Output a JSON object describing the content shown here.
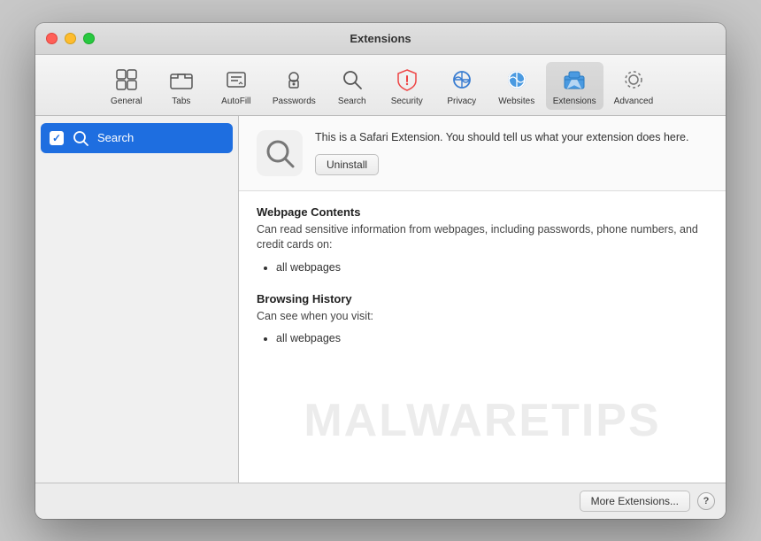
{
  "window": {
    "title": "Extensions",
    "controls": {
      "close": "close",
      "minimize": "minimize",
      "maximize": "maximize"
    }
  },
  "toolbar": {
    "items": [
      {
        "id": "general",
        "label": "General",
        "icon": "general"
      },
      {
        "id": "tabs",
        "label": "Tabs",
        "icon": "tabs"
      },
      {
        "id": "autofill",
        "label": "AutoFill",
        "icon": "autofill"
      },
      {
        "id": "passwords",
        "label": "Passwords",
        "icon": "passwords"
      },
      {
        "id": "search",
        "label": "Search",
        "icon": "search"
      },
      {
        "id": "security",
        "label": "Security",
        "icon": "security"
      },
      {
        "id": "privacy",
        "label": "Privacy",
        "icon": "privacy"
      },
      {
        "id": "websites",
        "label": "Websites",
        "icon": "websites"
      },
      {
        "id": "extensions",
        "label": "Extensions",
        "icon": "extensions",
        "active": true
      },
      {
        "id": "advanced",
        "label": "Advanced",
        "icon": "advanced"
      }
    ]
  },
  "sidebar": {
    "items": [
      {
        "id": "search-ext",
        "label": "Search",
        "checked": true,
        "selected": true
      }
    ]
  },
  "extension_detail": {
    "description": "This is a Safari Extension. You should tell us what your extension does here.",
    "uninstall_label": "Uninstall",
    "permissions": [
      {
        "title": "Webpage Contents",
        "desc": "Can read sensitive information from webpages, including passwords, phone numbers, and credit cards on:",
        "items": [
          "all webpages"
        ]
      },
      {
        "title": "Browsing History",
        "desc": "Can see when you visit:",
        "items": [
          "all webpages"
        ]
      }
    ]
  },
  "footer": {
    "more_extensions_label": "More Extensions...",
    "help_label": "?"
  },
  "watermark": "MALWARETIPS"
}
